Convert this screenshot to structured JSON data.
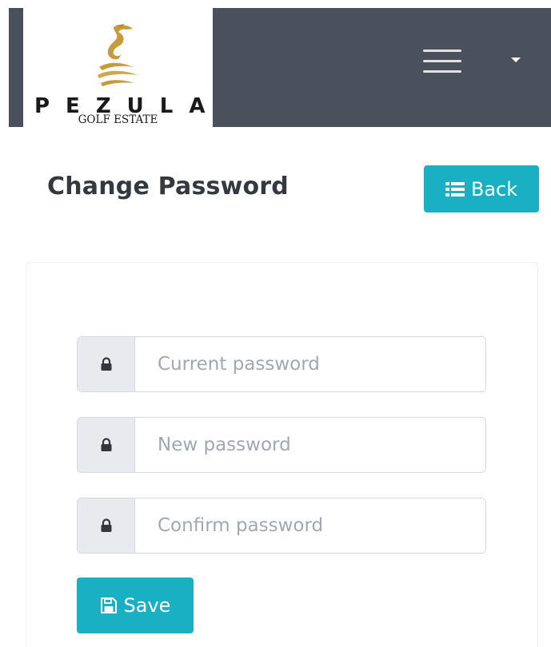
{
  "brand": {
    "name": "PEZULA",
    "tagline": "GOLF ESTATE"
  },
  "colors": {
    "navbar": "#4b505d",
    "accent": "#1ab0c4",
    "logo_gold": "#c99a3a"
  },
  "navbar": {
    "menu_icon": "hamburger-menu-icon",
    "dropdown_icon": "caret-down-icon"
  },
  "header": {
    "title": "Change Password",
    "back_label": "Back",
    "back_icon": "list-icon"
  },
  "form": {
    "fields": [
      {
        "icon": "lock-icon",
        "placeholder": "Current password",
        "value": ""
      },
      {
        "icon": "lock-icon",
        "placeholder": "New password",
        "value": ""
      },
      {
        "icon": "lock-icon",
        "placeholder": "Confirm password",
        "value": ""
      }
    ],
    "save_label": "Save",
    "save_icon": "floppy-disk-icon"
  }
}
